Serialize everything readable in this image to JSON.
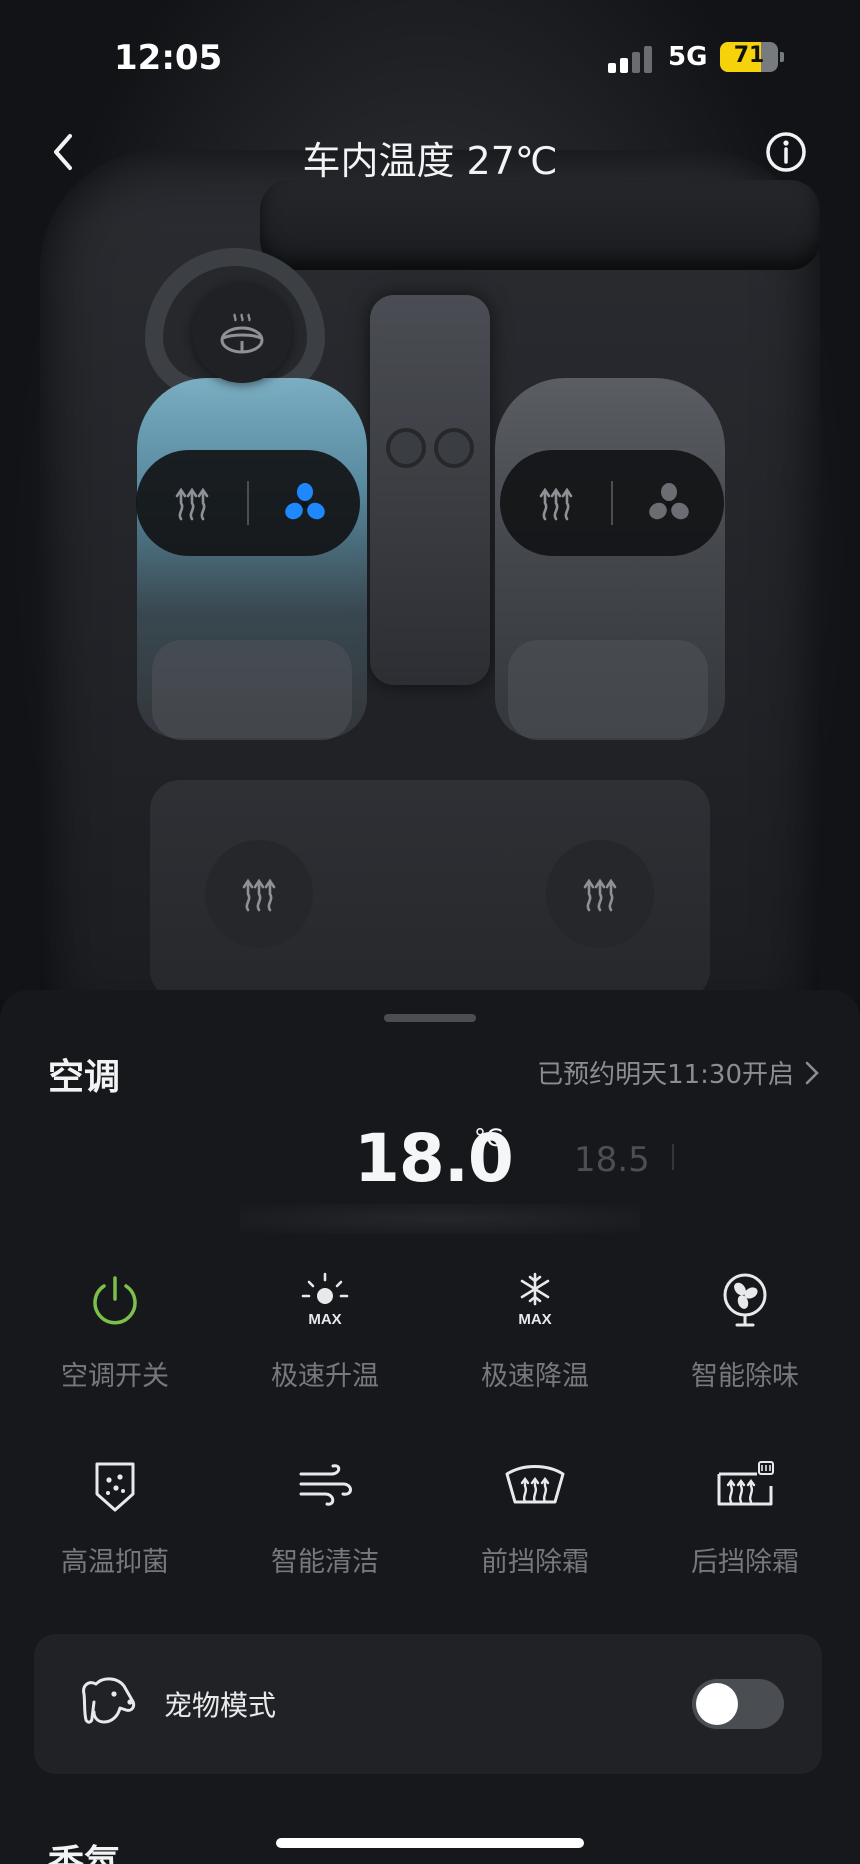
{
  "status_bar": {
    "time": "12:05",
    "network": "5G",
    "battery": "71",
    "battery_level": 0.71
  },
  "header": {
    "title": "车内温度 27℃"
  },
  "seats": {
    "driver": {
      "heat_icon": "seat-heat-icon",
      "vent_icon": "seat-vent-icon",
      "vent_active": true
    },
    "passenger": {
      "heat_icon": "seat-heat-icon",
      "vent_icon": "seat-vent-icon",
      "vent_active": false
    }
  },
  "ac": {
    "section_title": "空调",
    "schedule": "已预约明天11:30开启",
    "temperature": "18.0",
    "unit": "°C",
    "next_temperature": "18.5",
    "functions": [
      {
        "label": "空调开关",
        "icon": "power-icon"
      },
      {
        "label": "极速升温",
        "icon": "sun-max-icon"
      },
      {
        "label": "极速降温",
        "icon": "snowflake-max-icon"
      },
      {
        "label": "智能除味",
        "icon": "fan-purifier-icon"
      },
      {
        "label": "高温抑菌",
        "icon": "shield-sterilize-icon"
      },
      {
        "label": "智能清洁",
        "icon": "wind-clean-icon"
      },
      {
        "label": "前挡除霜",
        "icon": "front-defrost-icon"
      },
      {
        "label": "后挡除霜",
        "icon": "rear-defrost-icon"
      }
    ],
    "pet_mode": {
      "label": "宠物模式",
      "enabled": false
    }
  },
  "next_section": {
    "title": "香氛"
  },
  "colors": {
    "accent_blue": "#1e88ff",
    "power_green": "#7cc04a",
    "background": "#16181b"
  }
}
